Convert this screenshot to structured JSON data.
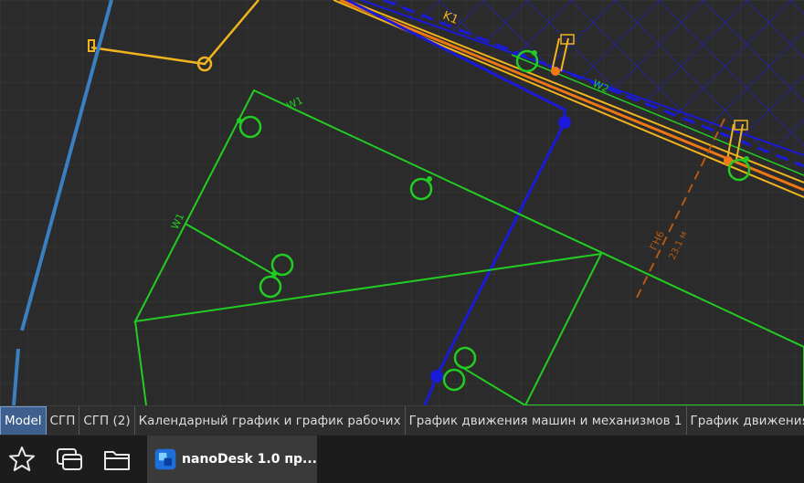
{
  "drawing": {
    "labels": {
      "w1_top": "W1",
      "w1_side": "W1",
      "w2": "W2",
      "k1": "K1",
      "gas": "ГН6",
      "gas_len": "23.1 м"
    }
  },
  "tabs": [
    {
      "label": "Model",
      "active": true
    },
    {
      "label": "СГП",
      "active": false
    },
    {
      "label": "СГП (2)",
      "active": false
    },
    {
      "label": "Календарный график и график рабочих",
      "active": false
    },
    {
      "label": "График движения машин и механизмов 1",
      "active": false
    },
    {
      "label": "График движения",
      "active": false
    }
  ],
  "taskbar": {
    "app_label": "nanoDesk 1.0 пр...",
    "icons": [
      "star-icon",
      "windows-icon",
      "folder-icon"
    ]
  },
  "colors": {
    "green": "#22cc22",
    "blue": "#1a1ad8",
    "yellow": "#f0b41e",
    "orange": "#f07814",
    "steelblue": "#3a7fc0",
    "brown": "#b45a14",
    "active_tab": "#3f5f8f"
  }
}
